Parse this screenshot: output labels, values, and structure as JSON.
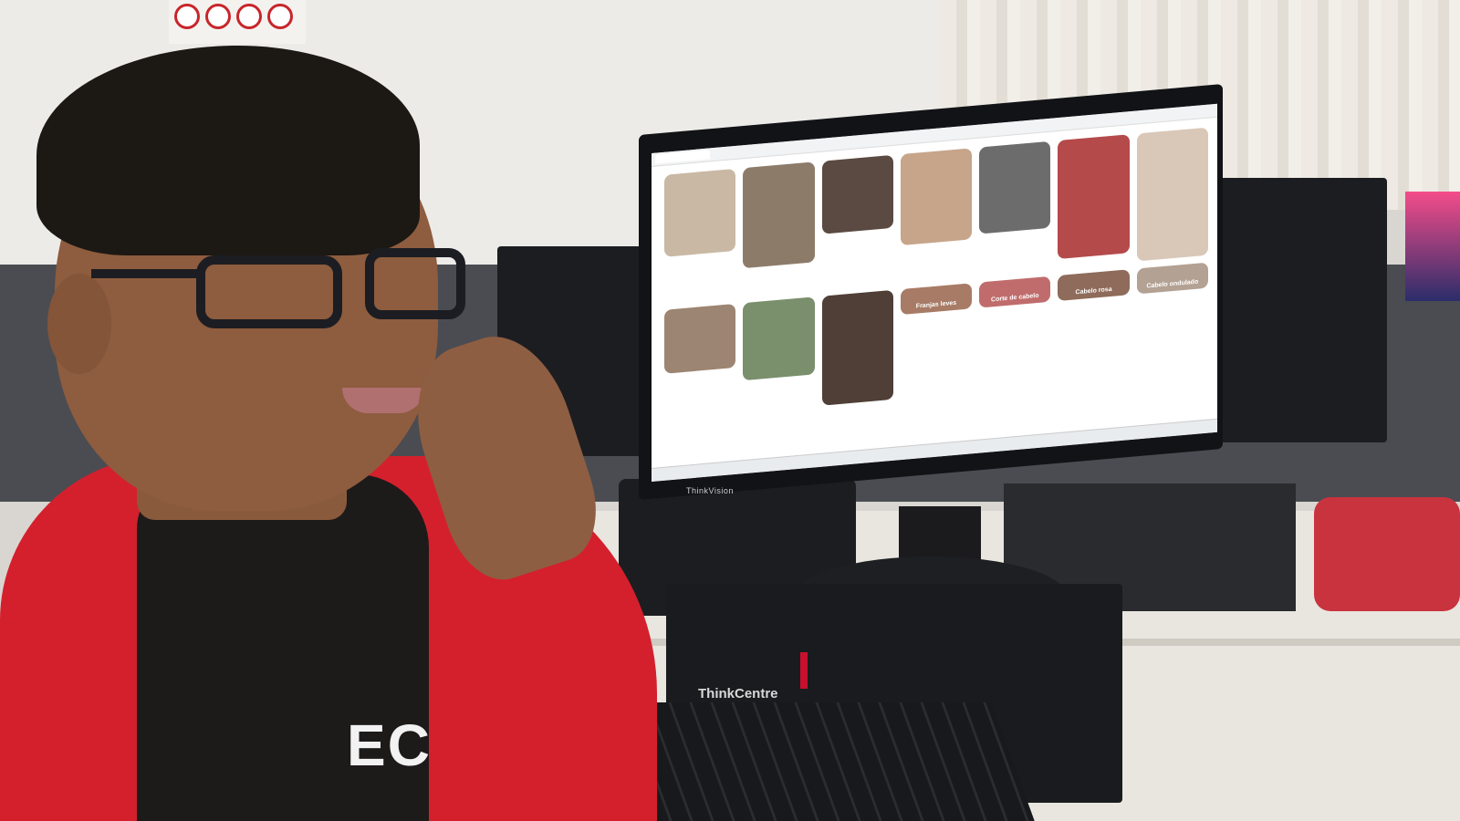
{
  "scene": {
    "monitor_brand": "ThinkVision",
    "pc_brand": "ThinkCentre",
    "shirt_logo": "EC",
    "pins": [
      {
        "color": "#c9b8a4",
        "caption": ""
      },
      {
        "color": "#8d7b6a",
        "caption": ""
      },
      {
        "color": "#5a4a42",
        "caption": ""
      },
      {
        "color": "#c7a58a",
        "caption": ""
      },
      {
        "color": "#6c6c6c",
        "caption": ""
      },
      {
        "color": "#b54a4a",
        "caption": ""
      },
      {
        "color": "#d9c7b8",
        "caption": ""
      },
      {
        "color": "#9c8572",
        "caption": ""
      },
      {
        "color": "#7a8f6c",
        "caption": ""
      },
      {
        "color": "#4f3f36",
        "caption": ""
      },
      {
        "color": "#a77b66",
        "caption": "Franjas leves"
      },
      {
        "color": "#c06c6c",
        "caption": "Corte de cabelo"
      },
      {
        "color": "#8e6b5a",
        "caption": "Cabelo rosa"
      },
      {
        "color": "#b3a194",
        "caption": "Cabelo ondulado"
      }
    ]
  }
}
